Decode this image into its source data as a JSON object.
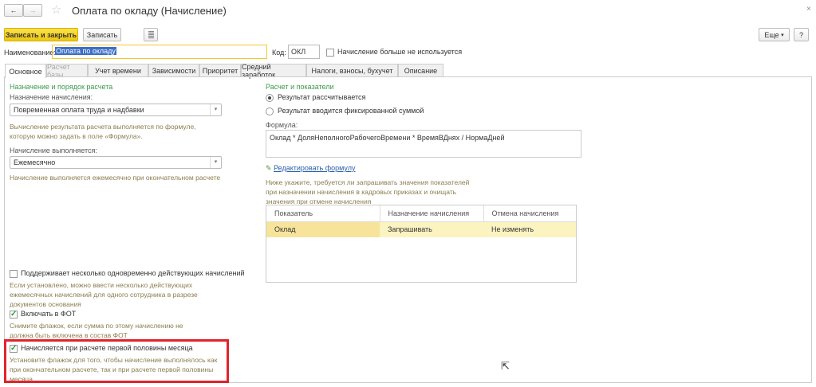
{
  "window": {
    "title": "Оплата по окладу (Начисление)",
    "close": "×"
  },
  "nav": {
    "back": "←",
    "forward": "→",
    "star": "☆"
  },
  "toolbar": {
    "save_close": "Записать и закрыть",
    "save": "Записать",
    "more": "Еще",
    "more_arrow": "▾",
    "help": "?"
  },
  "header": {
    "name_label": "Наименование:",
    "name_value": "Оплата по окладу",
    "code_label": "Код:",
    "code_value": "ОКЛ",
    "unused_label": "Начисление больше не используется"
  },
  "tabs": [
    "Основное",
    "Расчет базы",
    "Учет времени",
    "Зависимости",
    "Приоритет",
    "Средний заработок",
    "Налоги, взносы, бухучет",
    "Описание"
  ],
  "left": {
    "section_title": "Назначение и порядок расчета",
    "purpose_label": "Назначение начисления:",
    "purpose_value": "Повременная оплата труда и надбавки",
    "purpose_hint": "Вычисление результата расчета выполняется по формуле, которую можно задать в поле «Формула».",
    "frequency_label": "Начисление выполняется:",
    "frequency_value": "Ежемесячно",
    "frequency_hint": "Начисление выполняется ежемесячно при окончательном расчете",
    "multi_label": "Поддерживает несколько одновременно действующих начислений",
    "multi_hint": "Если установлено, можно ввести несколько действующих ежемесячных начислений для одного сотрудника в разрезе документов основания",
    "fot_label": "Включать в ФОТ",
    "fot_hint": "Снимите флажок, если сумма по этому начислению не должна быть включена в состав ФОТ",
    "half_label": "Начисляется при расчете первой половины месяца",
    "half_hint": "Установите флажок для того, чтобы начисление выполнялось как при окончательном расчете, так и при расчете первой половины месяца"
  },
  "right": {
    "section_title": "Расчет и показатели",
    "radio_calc": "Результат рассчитывается",
    "radio_fixed": "Результат вводится фиксированной суммой",
    "formula_label": "Формула:",
    "formula_value": "Оклад * ДоляНеполногоРабочегоВремени * ВремяВДнях / НормаДней",
    "edit_formula": "Редактировать формулу",
    "indicators_hint": "Ниже укажите, требуется ли запрашивать значения показателей при назначении начисления в кадровых приказах и очищать значения при отмене начисления",
    "table": {
      "headers": [
        "Показатель",
        "Назначение начисления",
        "Отмена начисления"
      ],
      "rows": [
        [
          "Оклад",
          "Запрашивать",
          "Не изменять"
        ]
      ]
    }
  },
  "colors": {
    "accent_yellow": "#f5d41f",
    "highlight": "#e0242b",
    "link": "#2a5ea8",
    "row_selected": "#fbf3c0"
  }
}
